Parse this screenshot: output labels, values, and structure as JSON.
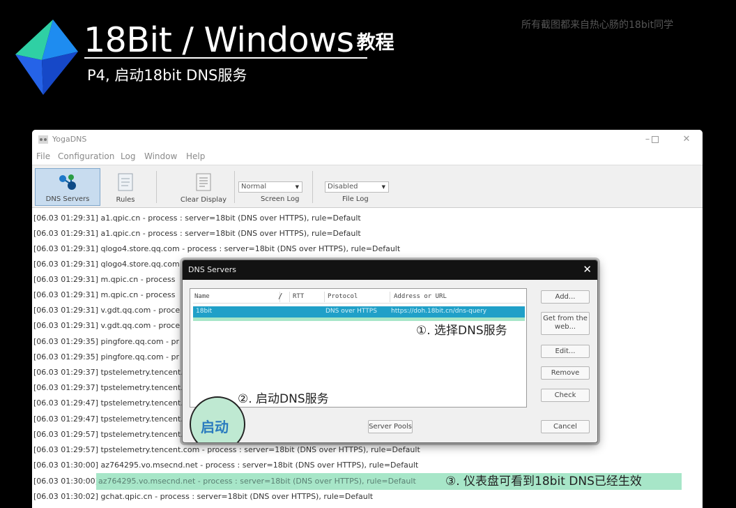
{
  "banner": {
    "title": "18Bit / Windows",
    "title_suffix": "教程",
    "subtitle": "P4, 启动18bit DNS服务",
    "corner_note": "所有截图都来自热心肠的18bit同学"
  },
  "window": {
    "title": "YogaDNS",
    "menu": [
      "File",
      "Configuration",
      "Log",
      "Window",
      "Help"
    ],
    "toolbar": {
      "dns_servers": "DNS Servers",
      "rules": "Rules",
      "clear_display": "Clear Display",
      "screen_log_value": "Normal",
      "screen_log_label": "Screen Log",
      "file_log_value": "Disabled",
      "file_log_label": "File Log"
    },
    "log_lines": [
      "[06.03 01:29:31] a1.qpic.cn - process : server=18bit (DNS over HTTPS), rule=Default",
      "[06.03 01:29:31] a1.qpic.cn - process : server=18bit (DNS over HTTPS), rule=Default",
      "[06.03 01:29:31] qlogo4.store.qq.com - process : server=18bit (DNS over HTTPS), rule=Default",
      "[06.03 01:29:31] qlogo4.store.qq.com",
      "[06.03 01:29:31] m.qpic.cn - process",
      "[06.03 01:29:31] m.qpic.cn - process",
      "[06.03 01:29:31] v.gdt.qq.com - proce",
      "[06.03 01:29:31] v.gdt.qq.com - proce",
      "[06.03 01:29:35] pingfore.qq.com - pr",
      "[06.03 01:29:35] pingfore.qq.com - pr",
      "[06.03 01:29:37] tpstelemetry.tencent.",
      "[06.03 01:29:37] tpstelemetry.tencent.",
      "[06.03 01:29:47] tpstelemetry.tencent.",
      "[06.03 01:29:47] tpstelemetry.tencent.",
      "[06.03 01:29:57] tpstelemetry.tencent.",
      "[06.03 01:29:57] tpstelemetry.tencent.com - process : server=18bit (DNS over HTTPS), rule=Default",
      "[06.03 01:30:00] az764295.vo.msecnd.net - process : server=18bit (DNS over HTTPS), rule=Default",
      "[06.03 01:30:00]",
      "[06.03 01:30:02] gchat.qpic.cn - process : server=18bit (DNS over HTTPS), rule=Default"
    ],
    "highlight_line": "az764295.vo.msecnd.net - process : server=18bit (DNS over HTTPS), rule=Default",
    "highlight_note": "③. 仪表盘可看到18bit DNS已经生效"
  },
  "dialog": {
    "title": "DNS Servers",
    "columns": {
      "name": "Name",
      "rtt": "RTT",
      "protocol": "Protocol",
      "address": "Address or URL"
    },
    "row": {
      "name": "18bit",
      "protocol": "DNS over HTTPS",
      "address": "https://doh.18bit.cn/dns-query"
    },
    "step1": "①. 选择DNS服务",
    "step2": "②. 启动DNS服务",
    "start_button": "启动",
    "buttons": {
      "add": "Add...",
      "get_from_web": "Get from the web...",
      "edit": "Edit...",
      "remove": "Remove",
      "check": "Check",
      "server_pools": "Server Pools",
      "cancel": "Cancel"
    }
  },
  "colors": {
    "background": "#000000",
    "selection": "#20a0c8",
    "highlight": "#a7e6c8",
    "start_text": "#2a7bbf",
    "dialog_titlebar": "#121212"
  }
}
